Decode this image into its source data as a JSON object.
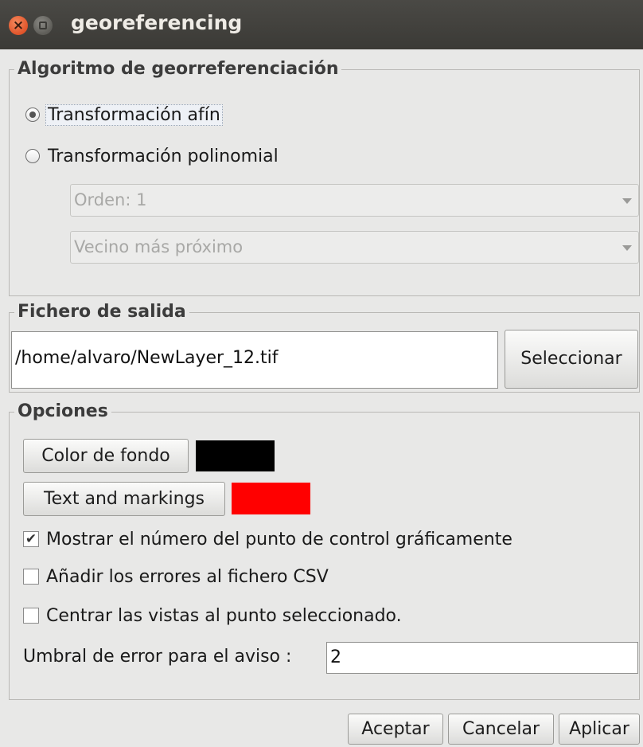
{
  "window": {
    "title": "georeferencing"
  },
  "algorithm": {
    "legend": "Algoritmo de georreferenciación",
    "affine_label": "Transformación afín",
    "polynomial_label": "Transformación polinomial",
    "selected": "affine",
    "order_select": "Orden: 1",
    "interpolation_select": "Vecino más próximo"
  },
  "output": {
    "legend": "Fichero de salida",
    "path": "/home/alvaro/NewLayer_12.tif",
    "select_label": "Seleccionar"
  },
  "options": {
    "legend": "Opciones",
    "bg_color_label": "Color de fondo",
    "bg_color": "#000000",
    "text_color_label": "Text and markings",
    "text_color": "#ff0000",
    "show_numbers_label": "Mostrar el número del punto de control gráficamente",
    "show_numbers_checked": true,
    "add_errors_label": "Añadir los errores al fichero CSV",
    "add_errors_checked": false,
    "center_views_label": "Centrar las vistas al punto seleccionado.",
    "center_views_checked": false,
    "threshold_label": "Umbral de error para el aviso :",
    "threshold_value": "2"
  },
  "footer": {
    "accept_label": "Aceptar",
    "cancel_label": "Cancelar",
    "apply_label": "Aplicar"
  }
}
